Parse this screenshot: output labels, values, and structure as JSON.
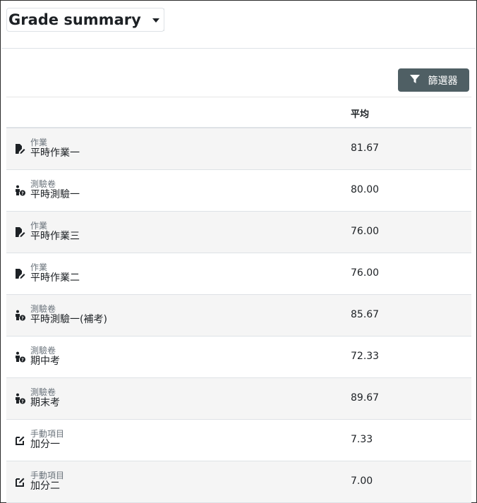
{
  "header": {
    "title": "Grade summary"
  },
  "toolbar": {
    "filter_label": "篩選器"
  },
  "table": {
    "col_average": "平均",
    "rows": [
      {
        "icon": "assignment-icon",
        "type": "作業",
        "name": "平時作業一",
        "avg": "81.67"
      },
      {
        "icon": "quiz-icon",
        "type": "測驗卷",
        "name": "平時測驗一",
        "avg": "80.00"
      },
      {
        "icon": "assignment-icon",
        "type": "作業",
        "name": "平時作業三",
        "avg": "76.00"
      },
      {
        "icon": "assignment-icon",
        "type": "作業",
        "name": "平時作業二",
        "avg": "76.00"
      },
      {
        "icon": "quiz-icon",
        "type": "測驗卷",
        "name": "平時測驗一(補考)",
        "avg": "85.67"
      },
      {
        "icon": "quiz-icon",
        "type": "測驗卷",
        "name": "期中考",
        "avg": "72.33"
      },
      {
        "icon": "quiz-icon",
        "type": "測驗卷",
        "name": "期末考",
        "avg": "89.67"
      },
      {
        "icon": "manual-item-icon",
        "type": "手動項目",
        "name": "加分一",
        "avg": "7.33"
      },
      {
        "icon": "manual-item-icon",
        "type": "手動項目",
        "name": "加分二",
        "avg": "7.00"
      }
    ]
  }
}
